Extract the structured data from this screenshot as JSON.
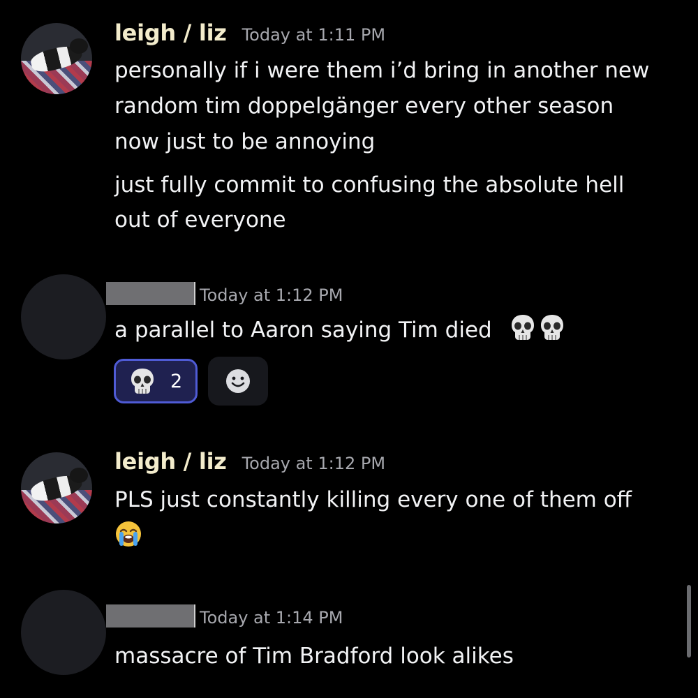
{
  "messages": [
    {
      "author": "leigh / liz",
      "timestamp": "Today at 1:11 PM",
      "lines": [
        "personally if i were them i’d bring in another new",
        "random tim doppelgänger every other season",
        "now just to be annoying",
        "just fully commit to confusing the absolute hell",
        "out of everyone"
      ]
    },
    {
      "author": "",
      "timestamp": "Today at 1:12 PM",
      "lines": [
        "a parallel to Aaron saying Tim died"
      ],
      "emoji": [
        "skull-icon",
        "skull-icon"
      ],
      "reaction": {
        "emoji": "skull-icon",
        "count": "2",
        "active_color": "#4f5bd5"
      }
    },
    {
      "author": "leigh / liz",
      "timestamp": "Today at 1:12 PM",
      "lines": [
        "PLS just constantly killing every one of them off"
      ],
      "emoji": [
        "loudly-crying-face-icon"
      ]
    },
    {
      "author": "",
      "timestamp": "Today at 1:14 PM",
      "lines": [
        "massacre of Tim Bradford look alikes"
      ]
    }
  ],
  "colors": {
    "background": "#000000",
    "username": "#f3eccc",
    "timestamp": "#a7a8ae",
    "text": "#f2f3f5"
  }
}
